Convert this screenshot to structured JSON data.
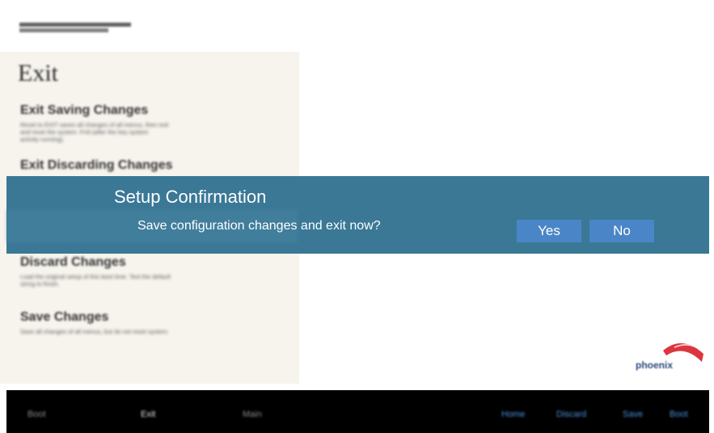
{
  "left_panel": {
    "section_title": "Exit",
    "items": [
      {
        "title": "Exit Saving Changes",
        "desc": [
          "Reset to EXIT saves all changes of all menus, then exit",
          "and reset the system. Fn9 (after the key system",
          "activity running)."
        ]
      },
      {
        "title": "Exit Discarding Changes",
        "desc": []
      },
      {
        "title": "Discard Changes",
        "desc": [
          "Load the original setup of this boot time. Test the default",
          "string to finish."
        ]
      },
      {
        "title": "Save Changes",
        "desc": [
          "Save all changes of all menus, but do not reset system."
        ]
      }
    ]
  },
  "dialog": {
    "title": "Setup Confirmation",
    "message": "Save configuration changes and exit now?",
    "yes_label": "Yes",
    "no_label": "No"
  },
  "logo": {
    "text": "phoenix"
  },
  "bottom_bar": {
    "left": [
      "Boot",
      "Exit",
      "Main"
    ],
    "right": [
      "Home",
      "Discard",
      "Save",
      "Boot"
    ]
  },
  "colors": {
    "dialog_bg": "#3a7896",
    "button_bg": "#4a86c7",
    "panel_bg": "#f7f4ee",
    "bottom_bar_bg": "#000000",
    "bottom_link": "#4c8fd8"
  }
}
